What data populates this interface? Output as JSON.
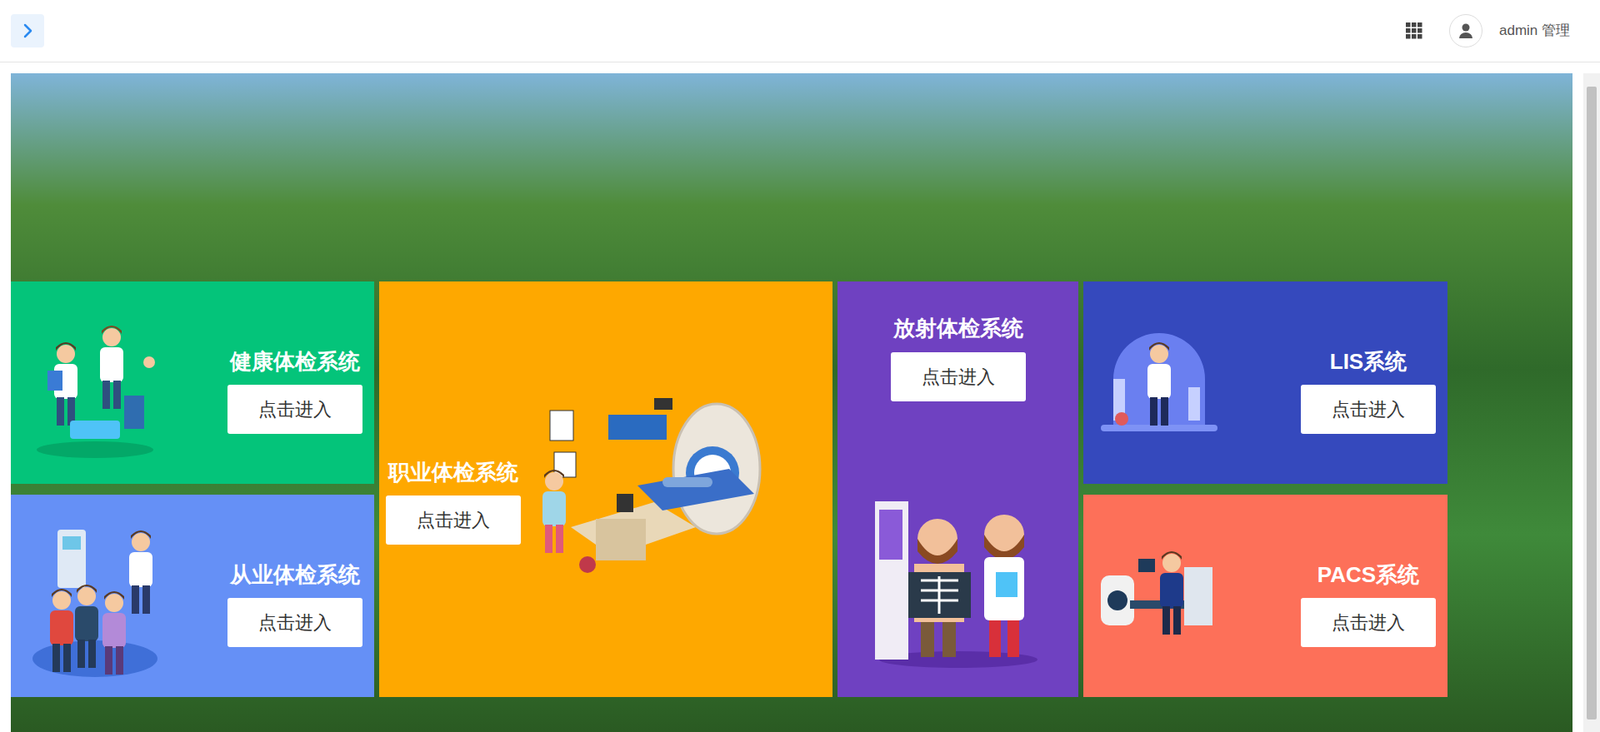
{
  "header": {
    "user": "admin 管理"
  },
  "systems": [
    {
      "name": "健康体检系统",
      "button": "点击进入",
      "kind": "side",
      "color": "#04c47a"
    },
    {
      "name": "从业体检系统",
      "button": "点击进入",
      "kind": "side",
      "color": "#6590f6"
    },
    {
      "name": "职业体检系统",
      "button": "点击进入",
      "kind": "wide",
      "color": "#fea800"
    },
    {
      "name": "放射体检系统",
      "button": "点击进入",
      "kind": "tall",
      "color": "#6f41c1"
    },
    {
      "name": "LIS系统",
      "button": "点击进入",
      "kind": "side",
      "color": "#3549bd"
    },
    {
      "name": "PACS系统",
      "button": "点击进入",
      "kind": "side",
      "color": "#fd7059"
    }
  ]
}
